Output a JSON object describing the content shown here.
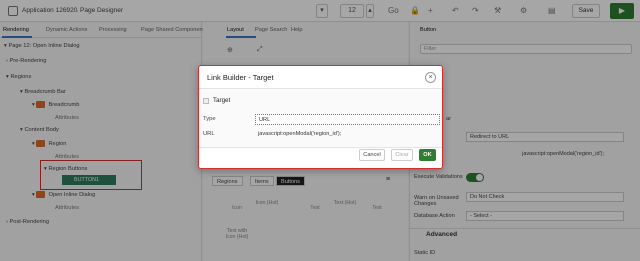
{
  "header": {
    "breadcrumb": [
      "Application 126920",
      "Page Designer"
    ],
    "page_number": "12",
    "save_label": "Save",
    "run_icon": "play-icon"
  },
  "left_panel": {
    "tabs": [
      "Rendering",
      "Dynamic Actions",
      "Processing",
      "Page Shared Component"
    ],
    "page_node": "Page 12: Open Inline Dialog",
    "tree": [
      {
        "label": "Pre-Rendering"
      },
      {
        "label": "Regions"
      },
      {
        "label": "Breadcrumb Bar"
      },
      {
        "label": "Breadcrumb"
      },
      {
        "label": "Attributes"
      },
      {
        "label": "Content Body"
      },
      {
        "label": "Region"
      },
      {
        "label": "Attributes"
      },
      {
        "label": "Region Buttons"
      },
      {
        "label": "BUTTON1"
      },
      {
        "label": "Open Inline Dialog"
      },
      {
        "label": "Attributes"
      },
      {
        "label": "Post-Rendering"
      }
    ]
  },
  "center_panel": {
    "tabs": [
      "Layout",
      "Page Search",
      "Help"
    ],
    "gallery_tabs": [
      "Regions",
      "Items",
      "Buttons"
    ],
    "gallery_items": [
      "Icon",
      "Icon (Hot)",
      "Text",
      "Text (Hot)",
      "Text",
      "Text with Icon (Hot)"
    ]
  },
  "right_panel": {
    "title": "Button",
    "filter_placeholder": "Filter",
    "behavior_partial": "ar",
    "action_value": "Redirect to URL",
    "target_value": "javascript:openModal('region_id');",
    "validations_label": "Execute Validations",
    "warn_label": "Warn on Unsaved Changes",
    "warn_value": "Do Not Check",
    "db_action_label": "Database Action",
    "db_action_value": "- Select -",
    "advanced_label": "Advanced",
    "static_id_label": "Static ID"
  },
  "modal": {
    "title": "Link Builder - Target",
    "section": "Target",
    "type_label": "Type",
    "type_value": "URL",
    "url_label": "URL",
    "url_value": "javascript:openModal('region_id');",
    "cancel_label": "Cancel",
    "clear_label": "Clear",
    "ok_label": "OK"
  }
}
